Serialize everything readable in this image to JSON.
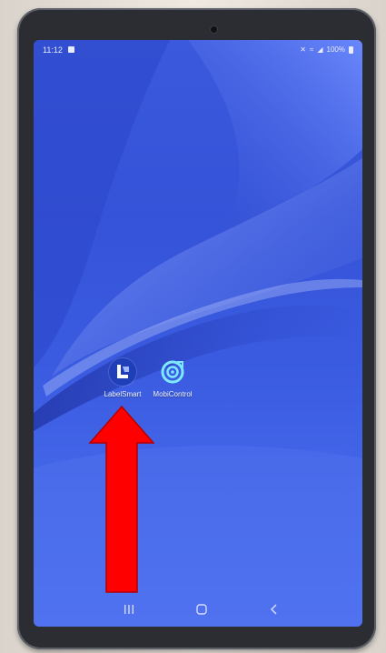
{
  "status_bar": {
    "time": "11:12",
    "icons": [
      "mute-icon",
      "wifi-icon",
      "signal-icon",
      "battery-icon"
    ],
    "battery": "100%"
  },
  "home_screen": {
    "apps": [
      {
        "label": "LabelSmart",
        "icon": "labelsmart-app-icon"
      },
      {
        "label": "MobiControl",
        "icon": "mobicontrol-app-icon"
      }
    ]
  },
  "navigation_bar": {
    "buttons": [
      "recents-icon",
      "home-icon",
      "back-icon"
    ]
  },
  "annotation": {
    "arrow_color": "#ff0000",
    "points_to": "LabelSmart"
  },
  "colors": {
    "wallpaper_primary": "#3553d8",
    "wallpaper_accent": "#9fb4ff",
    "device_frame": "#2b2d33",
    "mobicontrol_accent": "#7fe8ff"
  }
}
